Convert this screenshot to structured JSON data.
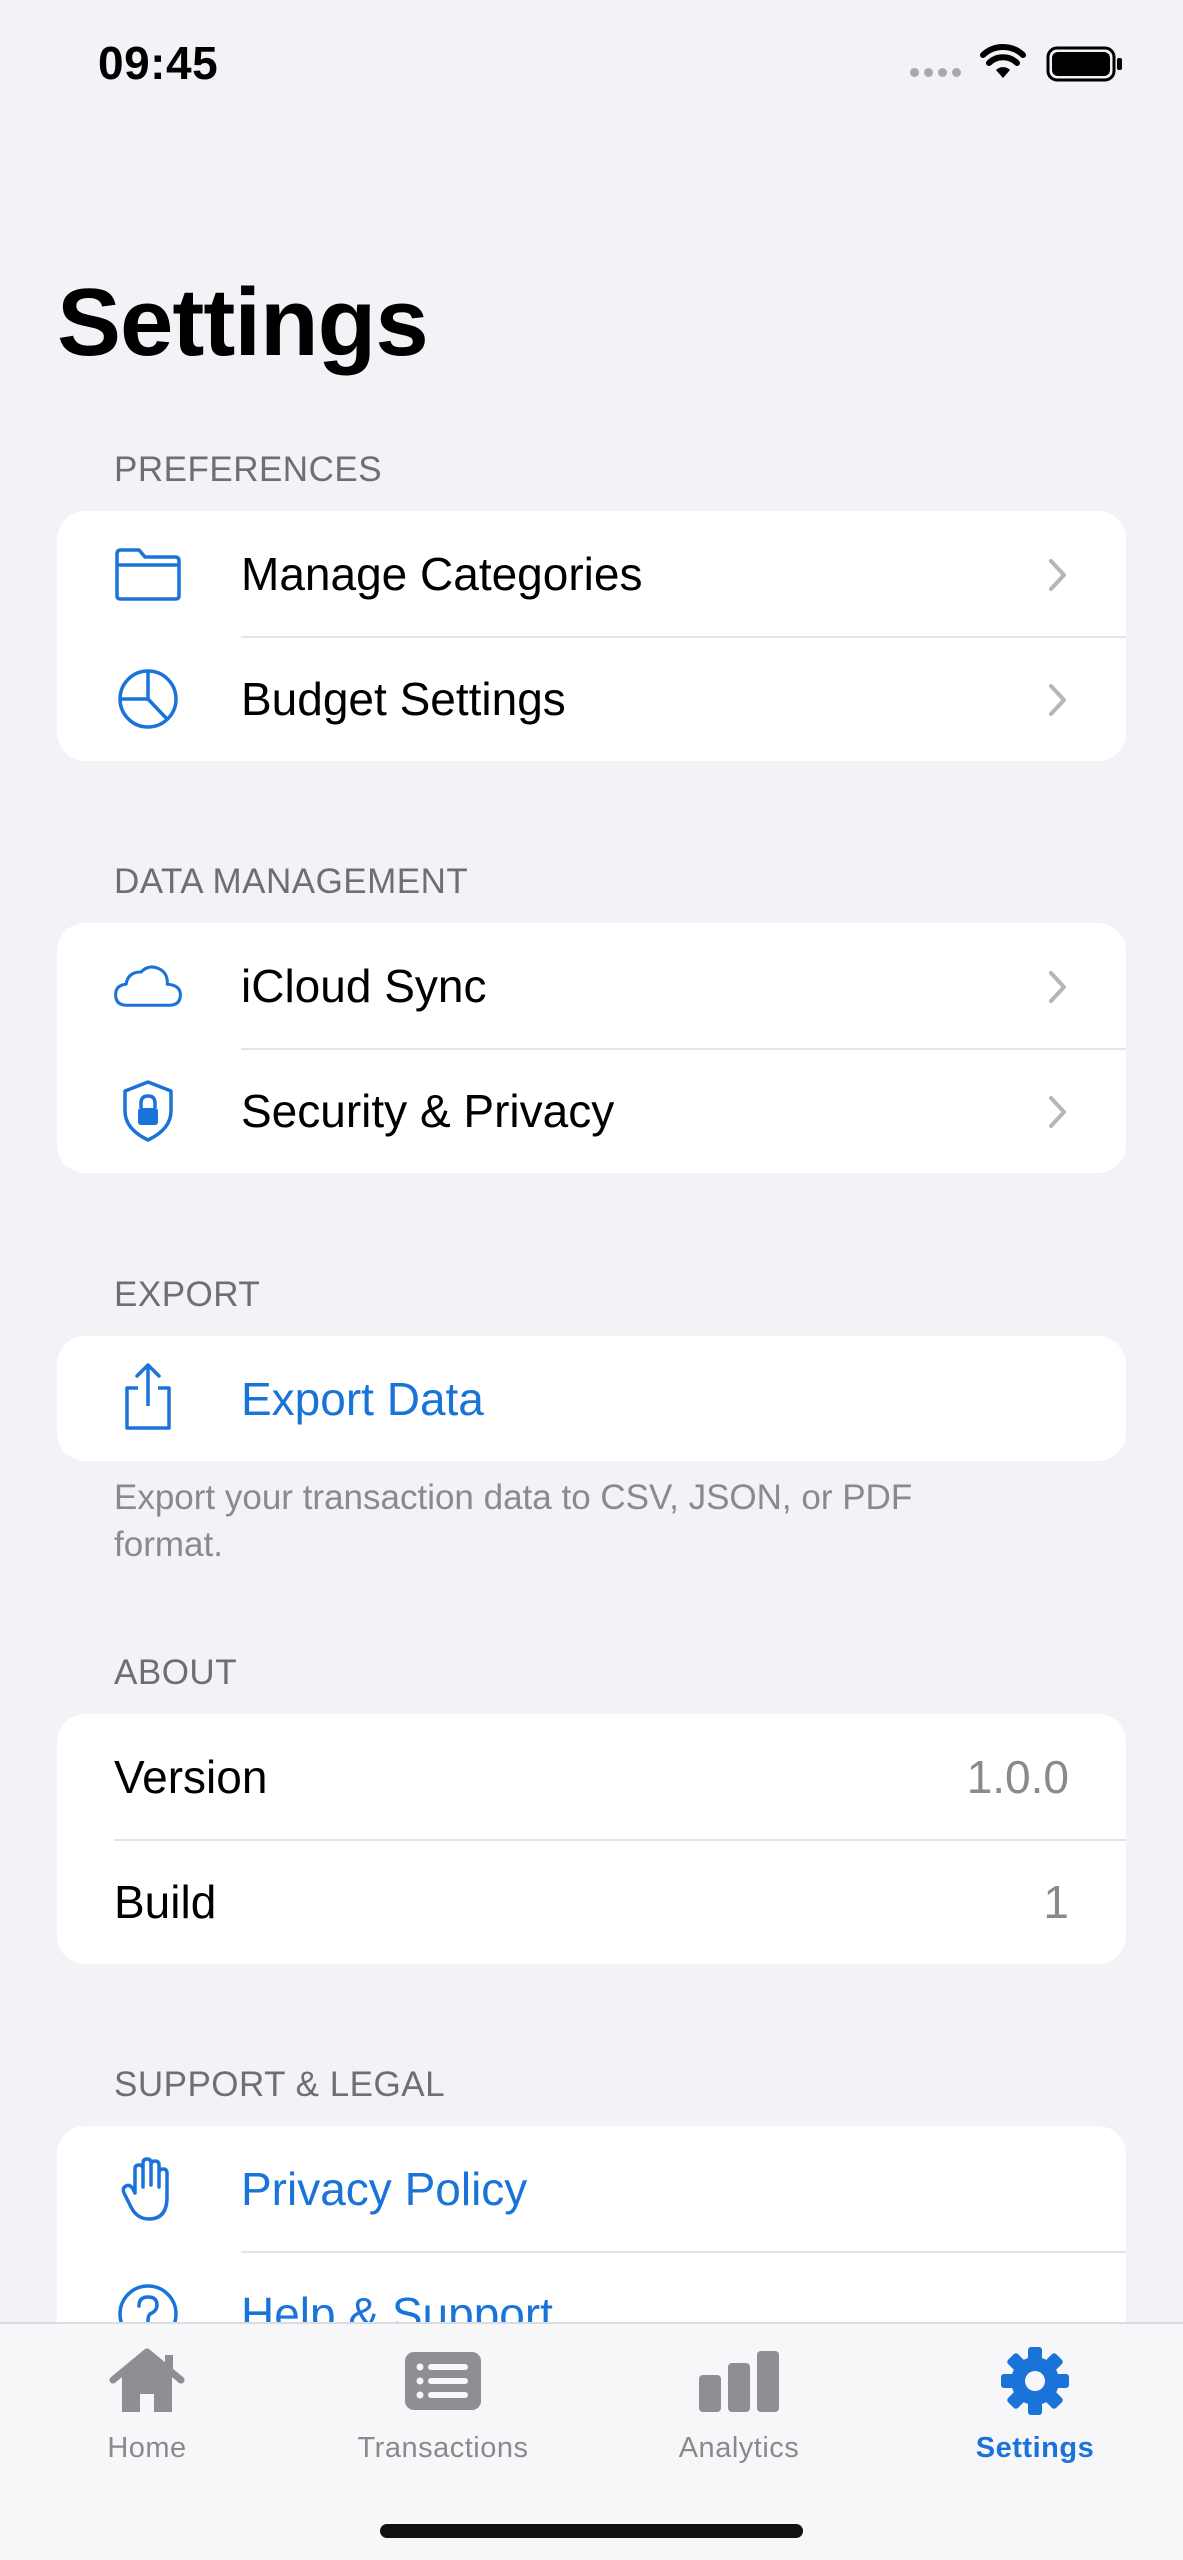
{
  "status_bar": {
    "time": "09:45"
  },
  "page": {
    "title": "Settings"
  },
  "colors": {
    "accent": "#1A73D9",
    "background": "#F2F2F7",
    "secondary_text": "#8A8A8E"
  },
  "sections": {
    "preferences": {
      "header": "PREFERENCES",
      "items": [
        {
          "label": "Manage Categories",
          "icon": "folder-icon"
        },
        {
          "label": "Budget Settings",
          "icon": "pie-chart-icon"
        }
      ]
    },
    "data_management": {
      "header": "DATA MANAGEMENT",
      "items": [
        {
          "label": "iCloud Sync",
          "icon": "cloud-icon"
        },
        {
          "label": "Security & Privacy",
          "icon": "lock-shield-icon"
        }
      ]
    },
    "export": {
      "header": "EXPORT",
      "items": [
        {
          "label": "Export Data",
          "icon": "share-icon"
        }
      ],
      "footer": "Export your transaction data to CSV, JSON, or PDF format."
    },
    "about": {
      "header": "ABOUT",
      "items": [
        {
          "label": "Version",
          "value": "1.0.0"
        },
        {
          "label": "Build",
          "value": "1"
        }
      ]
    },
    "support_legal": {
      "header": "SUPPORT & LEGAL",
      "items": [
        {
          "label": "Privacy Policy",
          "icon": "hand-raised-icon"
        },
        {
          "label": "Help & Support",
          "icon": "question-circle-icon"
        }
      ]
    }
  },
  "tab_bar": {
    "tabs": [
      {
        "label": "Home",
        "icon": "house-icon",
        "active": false
      },
      {
        "label": "Transactions",
        "icon": "list-icon",
        "active": false
      },
      {
        "label": "Analytics",
        "icon": "bar-chart-icon",
        "active": false
      },
      {
        "label": "Settings",
        "icon": "gear-icon",
        "active": true
      }
    ]
  }
}
